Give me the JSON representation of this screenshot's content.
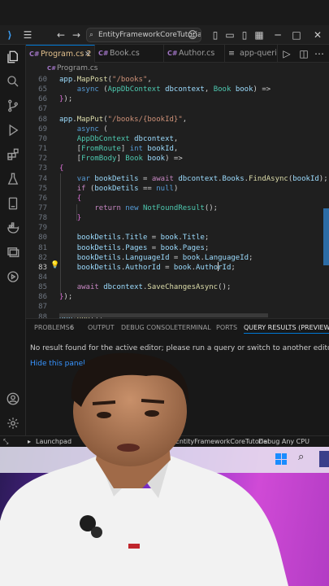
{
  "titlebar": {
    "search_text": "EntityFrameworkCoreTutorial"
  },
  "tabs": [
    {
      "label": "Program.cs",
      "suffix": "2",
      "active": true
    },
    {
      "label": "Book.cs",
      "active": false
    },
    {
      "label": "Author.cs",
      "active": false
    },
    {
      "label": "app-queries.sq",
      "active": false
    }
  ],
  "breadcrumb": "Program.cs",
  "code_lines": [
    {
      "n": "60",
      "html": "<span class='v'>app</span>.<span class='f'>MapPost</span>(<span class='s'>\"/books\"</span>,"
    },
    {
      "n": "65",
      "html": "    <span class='k'>async</span> (<span class='t'>AppDbContext</span> <span class='v'>dbcontext</span>, <span class='t'>Book</span> <span class='v'>book</span>) =>"
    },
    {
      "n": "66",
      "html": "<span class='br'>}</span>);"
    },
    {
      "n": "67",
      "html": ""
    },
    {
      "n": "68",
      "html": "<span class='v'>app</span>.<span class='f'>MapPut</span>(<span class='s'>\"/books/{bookId}\"</span>,"
    },
    {
      "n": "69",
      "html": "    <span class='k'>async</span> ("
    },
    {
      "n": "70",
      "html": "    <span class='t'>AppDbContext</span> <span class='v'>dbcontext</span>,"
    },
    {
      "n": "71",
      "html": "    [<span class='t'>FromRoute</span>] <span class='k'>int</span> <span class='v'>bookId</span>,"
    },
    {
      "n": "72",
      "html": "    [<span class='t'>FromBody</span>] <span class='t'>Book</span> <span class='v'>book</span>) =>"
    },
    {
      "n": "73",
      "html": "<span class='br'>{</span>"
    },
    {
      "n": "74",
      "html": "    <span class='k'>var</span> <span class='v'>bookDetils</span> = <span class='ctl'>await</span> <span class='v'>dbcontext</span>.<span class='v'>Books</span>.<span class='f'>FindAsync</span>(<span class='v'>bookId</span>);"
    },
    {
      "n": "75",
      "html": "    <span class='ctl'>if</span> (<span class='v'>bookDetils</span> == <span class='k'>null</span>)"
    },
    {
      "n": "76",
      "html": "    <span class='br'>{</span>"
    },
    {
      "n": "77",
      "html": "        <span class='ctl'>return</span> <span class='k'>new</span> <span class='t'>NotFoundResult</span>();"
    },
    {
      "n": "78",
      "html": "    <span class='br'>}</span>"
    },
    {
      "n": "79",
      "html": ""
    },
    {
      "n": "80",
      "html": "    <span class='v'>bookDetils</span>.<span class='v'>Title</span> = <span class='v'>book</span>.<span class='v'>Title</span>;"
    },
    {
      "n": "81",
      "html": "    <span class='v'>bookDetils</span>.<span class='v'>Pages</span> = <span class='v'>book</span>.<span class='v'>Pages</span>;"
    },
    {
      "n": "82",
      "html": "    <span class='v'>bookDetils</span>.<span class='v'>LanguageId</span> = <span class='v'>book</span>.<span class='v'>LanguageId</span>;"
    },
    {
      "n": "83",
      "html": "    <span class='v'>bookDetils</span>.<span class='v'>AuthorId</span> = <span class='v'>book</span>.<span class='v'>AuthorId</span>;"
    },
    {
      "n": "84",
      "html": ""
    },
    {
      "n": "85",
      "html": "    <span class='ctl'>await</span> <span class='v'>dbcontext</span>.<span class='f'>SaveChangesAsync</span>();"
    },
    {
      "n": "86",
      "html": "<span class='br'>}</span>);"
    },
    {
      "n": "87",
      "html": ""
    },
    {
      "n": "88",
      "html": "<span class='v'>app</span>.<span class='f'>Run</span>();"
    }
  ],
  "panel": {
    "tabs": [
      "PROBLEMS",
      "OUTPUT",
      "DEBUG CONSOLE",
      "TERMINAL",
      "PORTS",
      "QUERY RESULTS (PREVIEW)"
    ],
    "problems_count": "6",
    "message": "No result found for the active editor; please run a query or switch to another editor.",
    "link": "Hide this panel"
  },
  "statusbar": {
    "launchpad": "Launchpad",
    "projects": "Projects: EntityFrameworkCoreTutorial",
    "debug": "Debug Any CPU"
  },
  "colors": {
    "accent": "#0078d4",
    "editor_bg": "#1f1f1f",
    "taskbar_gradient_mid": "#7a2ec8"
  }
}
